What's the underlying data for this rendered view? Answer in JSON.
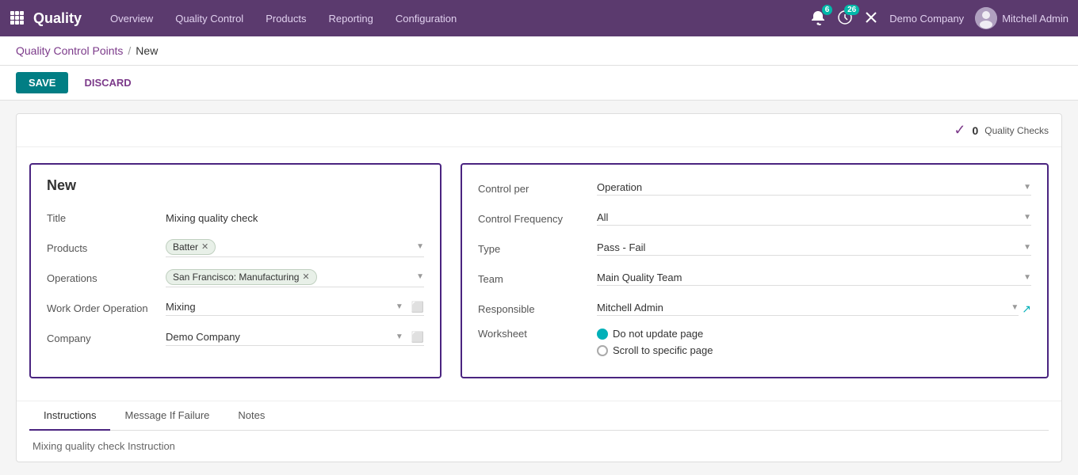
{
  "nav": {
    "brand": "Quality",
    "items": [
      {
        "label": "Overview",
        "id": "overview"
      },
      {
        "label": "Quality Control",
        "id": "quality-control"
      },
      {
        "label": "Products",
        "id": "products"
      },
      {
        "label": "Reporting",
        "id": "reporting"
      },
      {
        "label": "Configuration",
        "id": "configuration"
      }
    ],
    "notifications_count": "6",
    "activity_count": "26",
    "company": "Demo Company",
    "user": "Mitchell Admin"
  },
  "breadcrumb": {
    "parent": "Quality Control Points",
    "separator": "/",
    "current": "New"
  },
  "actions": {
    "save": "SAVE",
    "discard": "DISCARD"
  },
  "quality_checks": {
    "count": "0",
    "label": "Quality Checks"
  },
  "form_left": {
    "title": "New",
    "fields": {
      "title_label": "Title",
      "title_value": "Mixing quality check",
      "products_label": "Products",
      "products_tag": "Batter",
      "operations_label": "Operations",
      "operations_tag": "San Francisco: Manufacturing",
      "work_order_label": "Work Order Operation",
      "work_order_value": "Mixing",
      "company_label": "Company",
      "company_value": "Demo Company"
    }
  },
  "form_right": {
    "fields": {
      "control_per_label": "Control per",
      "control_per_value": "Operation",
      "control_freq_label": "Control Frequency",
      "control_freq_value": "All",
      "type_label": "Type",
      "type_value": "Pass - Fail",
      "team_label": "Team",
      "team_value": "Main Quality Team",
      "responsible_label": "Responsible",
      "responsible_value": "Mitchell Admin",
      "worksheet_label": "Worksheet",
      "worksheet_option1": "Do not update page",
      "worksheet_option2": "Scroll to specific page"
    }
  },
  "tabs": {
    "items": [
      {
        "label": "Instructions",
        "id": "instructions",
        "active": true
      },
      {
        "label": "Message If Failure",
        "id": "message-if-failure",
        "active": false
      },
      {
        "label": "Notes",
        "id": "notes",
        "active": false
      }
    ],
    "content": "Mixing quality check Instruction"
  }
}
